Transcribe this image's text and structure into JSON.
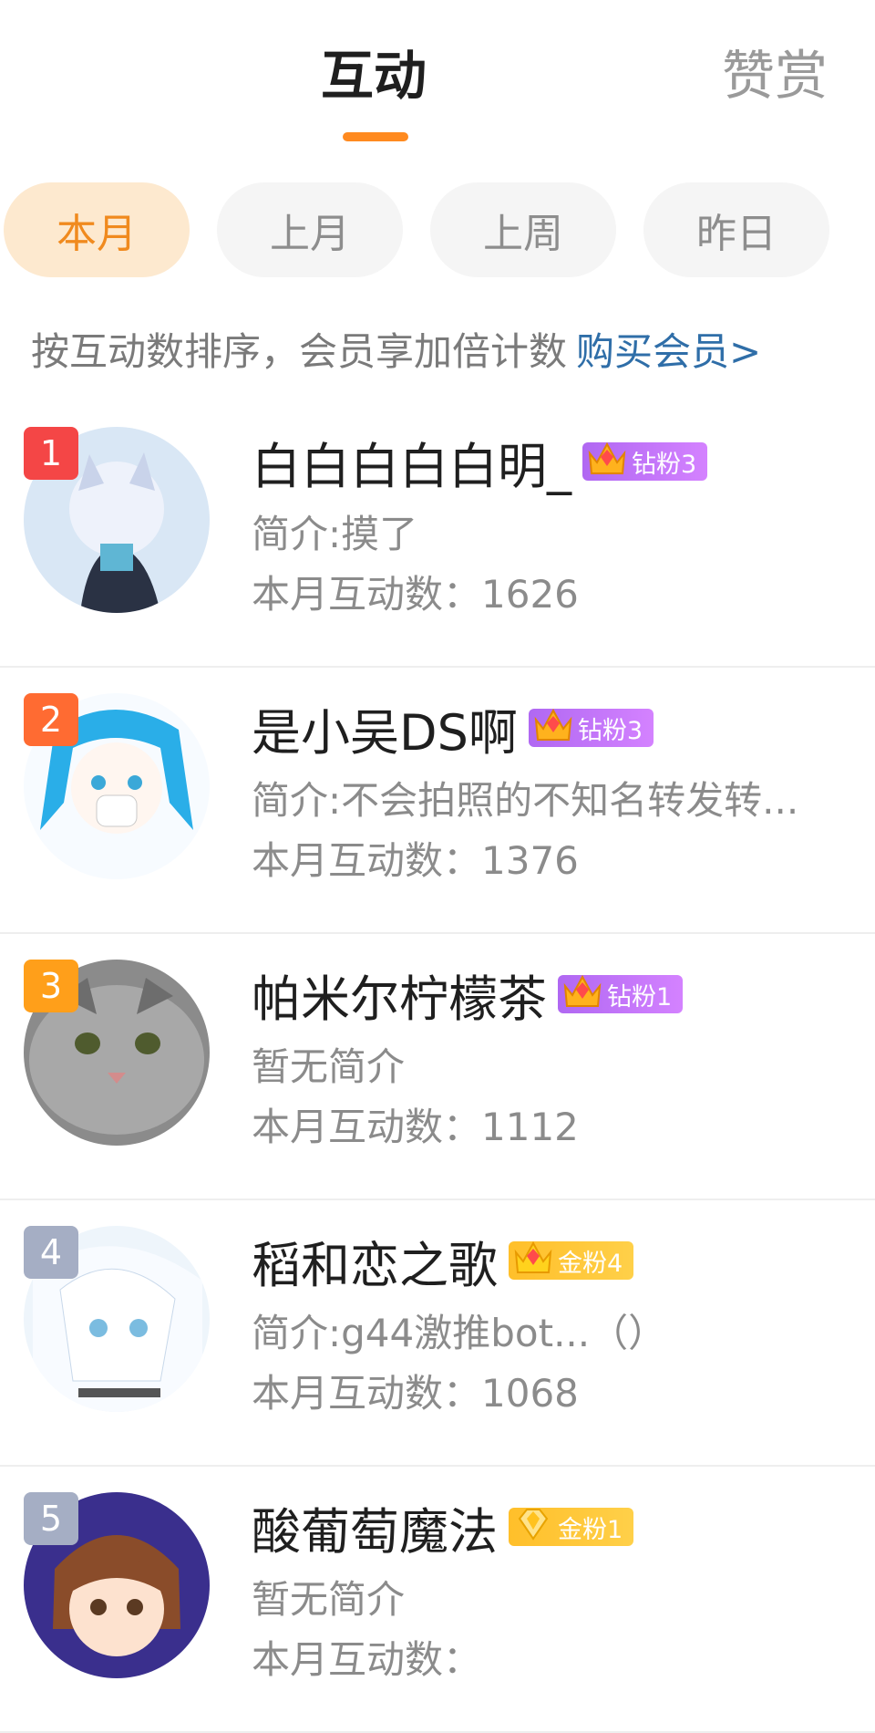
{
  "tabs": {
    "active": "互动",
    "inactive": "赞赏"
  },
  "filters": [
    "本月",
    "上月",
    "上周",
    "昨日"
  ],
  "hint": {
    "text": "按互动数排序，会员享加倍计数",
    "link": "购买会员>"
  },
  "colors": {
    "accent": "#ff8a1f",
    "active_chip_bg": "#fde9cf",
    "chip_bg": "#f5f5f5",
    "link": "#2f6ea8",
    "rank1": "#f44646",
    "rank2": "#ff6b32",
    "rank3": "#ff9f1a",
    "rank_other": "#a5aec4",
    "diamond_badge": "#c47cf7",
    "gold_badge": "#ffc32f"
  },
  "entries": [
    {
      "rank": "1",
      "name": "白白白白白明_",
      "badge_num": "1",
      "badge_text": "钻粉3",
      "badge_icon": "crown-icon",
      "intro": "简介:摸了",
      "count": "本月互动数：1626"
    },
    {
      "rank": "2",
      "name": "是小吴DS啊",
      "badge_num": "6",
      "badge_text": "钻粉3",
      "badge_icon": "crown-icon",
      "intro": "简介:不会拍照的不知名转发转...",
      "count": "本月互动数：1376"
    },
    {
      "rank": "3",
      "name": "帕米尔柠檬茶",
      "badge_num": "2",
      "badge_text": "钻粉1",
      "badge_icon": "crown-icon",
      "intro": "暂无简介",
      "count": "本月互动数：1112"
    },
    {
      "rank": "4",
      "name": "稻和恋之歌",
      "badge_num": "1",
      "badge_text": "金粉4",
      "badge_icon": "crown-icon",
      "intro": "简介:g44激推bot...（）",
      "count": "本月互动数：1068"
    },
    {
      "rank": "5",
      "name": "酸葡萄魔法",
      "badge_num": "",
      "badge_text": "金粉1",
      "badge_icon": "diamond-icon",
      "intro": "暂无简介",
      "count": "本月互动数："
    }
  ]
}
